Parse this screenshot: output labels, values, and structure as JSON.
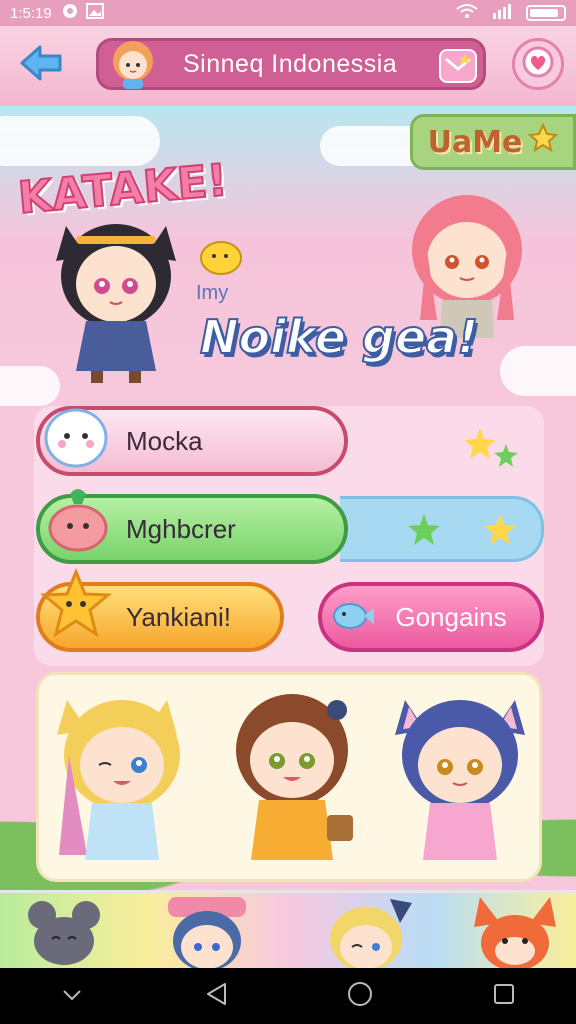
{
  "status_bar": {
    "time": "1:5:19",
    "icons": [
      "circle-notification-icon",
      "image-notification-icon",
      "wifi-icon",
      "signal-icon",
      "battery-icon"
    ]
  },
  "header": {
    "title": "Sinneq Indonessia",
    "back_icon": "arrow-left-icon",
    "message_icon": "mail-heart-icon",
    "settings_icon": "gear-heart-icon"
  },
  "hero": {
    "logo": "KATAKE!",
    "badge": "UaMe",
    "tagline_small": "Imy",
    "tagline_big": "Noike gea!"
  },
  "menu": {
    "buttons": [
      {
        "label": "Mocka",
        "color": "#f5bcd3"
      },
      {
        "label": "Mghbcrer",
        "color": "#79d36b"
      },
      {
        "label": "Yankiani!",
        "color": "#f7a62c"
      },
      {
        "label": "Gongains",
        "color": "#ec5aa0"
      }
    ]
  },
  "roster": {
    "characters": [
      "blonde-girl-character",
      "brown-hair-girl-character",
      "blue-hair-cat-girl-character"
    ]
  },
  "bottom_strip": {
    "characters": [
      "gray-mouse-character",
      "striped-hat-girl-character",
      "blonde-girl-character",
      "orange-fox-character"
    ]
  },
  "nav": {
    "icons": [
      "chevron-down-icon",
      "back-triangle-icon",
      "home-circle-icon",
      "recent-square-icon"
    ]
  },
  "colors": {
    "accent": "#cf5f95",
    "background": "#f7c8dc"
  }
}
